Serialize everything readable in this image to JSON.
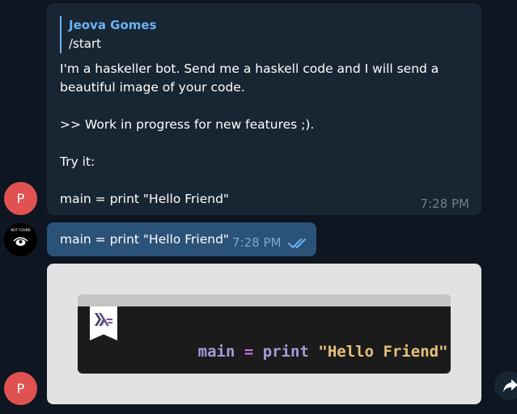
{
  "messages": [
    {
      "sender_initial": "P",
      "reply": {
        "name": "Jeova Gomes",
        "text": "/start"
      },
      "text": "I'm a haskeller bot. Send me a haskell code and I will send a\nbeautiful image of your code.\n\n>> Work in progress for new features ;).\n\nTry it:\n\nmain = print \"Hello Friend\"",
      "time": "7:28 PM"
    },
    {
      "avatar_label": "NOT FOUND",
      "text": "main = print \"Hello Friend\"",
      "time": "7:28 PM",
      "status": "read"
    },
    {
      "sender_initial": "P",
      "code_image": {
        "tokens": [
          {
            "text": "main",
            "kind": "name"
          },
          {
            "text": " = ",
            "kind": "op"
          },
          {
            "text": "print",
            "kind": "name"
          },
          {
            "text": " ",
            "kind": "op"
          },
          {
            "text": "\"Hello Friend\"",
            "kind": "str"
          }
        ],
        "colors": {
          "name": "#a89ad8",
          "op": "#c678dd",
          "str": "#e5c07b",
          "background": "#1b1b1b",
          "titlebar": "#c4c4c4"
        }
      }
    }
  ],
  "icons": {
    "forward": "share-forward-icon",
    "read_status": "double-check-icon",
    "logo": "haskell-logo-icon"
  },
  "colors": {
    "background": "#0e1621",
    "incoming_bubble": "#182533",
    "outgoing_bubble": "#2b5278",
    "accent": "#6ab2f2",
    "avatar_red": "#e05252"
  }
}
